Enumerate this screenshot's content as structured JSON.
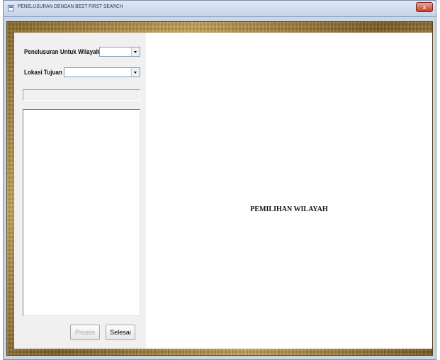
{
  "window": {
    "title": "PENELUSURAN DENGAN BEST FIRST SEARCH",
    "close_label": "x"
  },
  "form": {
    "region_label": "Penelusuran Untuk Wilayah",
    "region_value": "",
    "destination_label": "Lokasi Tujuan",
    "destination_value": "",
    "status_text": "",
    "list_items": []
  },
  "buttons": {
    "process_label": "Proses",
    "finish_label": "Selesai"
  },
  "map": {
    "title": "PEMILIHAN WILAYAH"
  }
}
